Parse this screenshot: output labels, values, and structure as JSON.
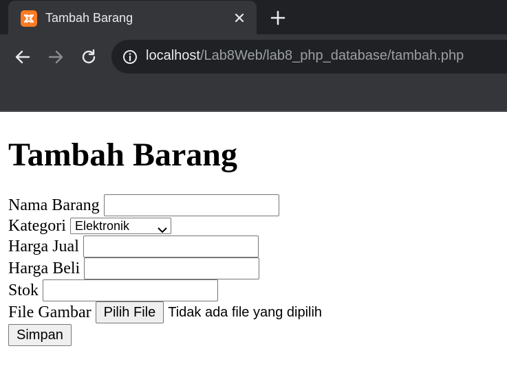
{
  "browser": {
    "tab_title": "Tambah Barang",
    "favicon": "xampp-icon",
    "url_host": "localhost",
    "url_path": "/Lab8Web/lab8_php_database/tambah.php",
    "colors": {
      "tabstrip": "#202124",
      "toolbar": "#35363a",
      "favicon": "#fb7a24"
    }
  },
  "page": {
    "heading": "Tambah Barang",
    "form": {
      "nama_label": "Nama Barang",
      "nama_value": "",
      "kategori_label": "Kategori",
      "kategori_selected": "Elektronik",
      "harga_jual_label": "Harga Jual",
      "harga_jual_value": "",
      "harga_beli_label": "Harga Beli",
      "harga_beli_value": "",
      "stok_label": "Stok",
      "stok_value": "",
      "file_label": "File Gambar",
      "file_button": "Pilih File",
      "file_status": "Tidak ada file yang dipilih",
      "submit_label": "Simpan"
    }
  }
}
